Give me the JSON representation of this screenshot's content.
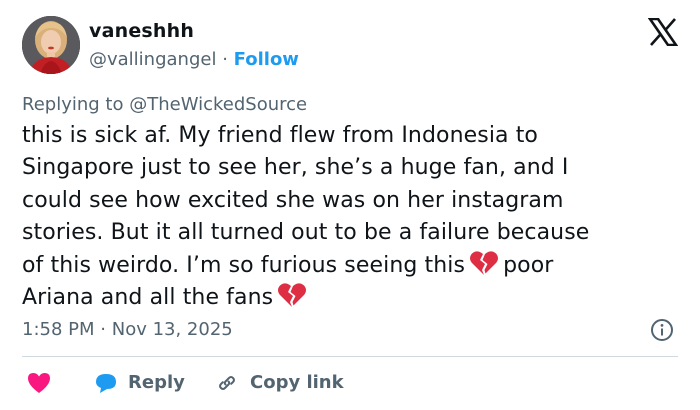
{
  "header": {
    "display_name": "vaneshhh",
    "handle": "@vallingangel",
    "separator": "·",
    "follow_label": "Follow"
  },
  "reply": {
    "prefix": "Replying to",
    "target": "@TheWickedSource"
  },
  "tweet": {
    "lines": [
      "this is sick af. My friend flew from Indonesia to",
      "Singapore just to see her, she’s a huge fan, and I",
      "could see how excited she was on her instagram",
      "stories. But it all turned out to be a failure because",
      "of this weirdo. I’m so furious seeing this",
      "poor",
      "Ariana and all the fans"
    ],
    "emoji": "broken-heart"
  },
  "meta": {
    "time": "1:58 PM",
    "separator": "·",
    "date": "Nov 13, 2025"
  },
  "actions": {
    "reply_label": "Reply",
    "copy_label": "Copy link"
  },
  "colors": {
    "accent": "#1d9bf0",
    "heart": "#f91880",
    "text": "#0f1419",
    "muted": "#536471",
    "divider": "#cfd9de"
  },
  "icons": [
    "x-logo-icon",
    "broken-heart-icon",
    "info-icon",
    "heart-icon",
    "reply-bubble-icon",
    "link-icon"
  ]
}
